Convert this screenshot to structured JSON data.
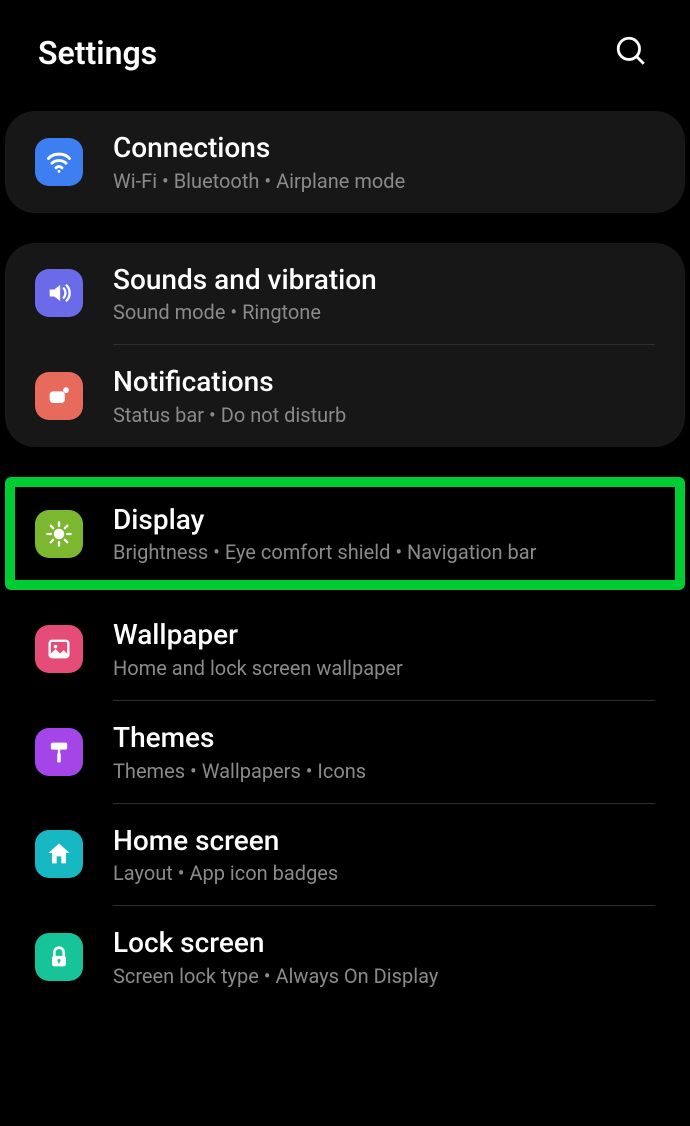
{
  "header": {
    "title": "Settings"
  },
  "groups": [
    {
      "type": "card",
      "items": [
        {
          "id": "connections",
          "title": "Connections",
          "subtitle": "Wi-Fi  •  Bluetooth  •  Airplane mode"
        }
      ]
    },
    {
      "type": "card",
      "items": [
        {
          "id": "sounds",
          "title": "Sounds and vibration",
          "subtitle": "Sound mode  •  Ringtone"
        },
        {
          "id": "notifications",
          "title": "Notifications",
          "subtitle": "Status bar  •  Do not disturb"
        }
      ]
    },
    {
      "type": "highlighted",
      "items": [
        {
          "id": "display",
          "title": "Display",
          "subtitle": "Brightness  •  Eye comfort shield  •  Navigation bar"
        }
      ]
    },
    {
      "type": "plain",
      "items": [
        {
          "id": "wallpaper",
          "title": "Wallpaper",
          "subtitle": "Home and lock screen wallpaper"
        },
        {
          "id": "themes",
          "title": "Themes",
          "subtitle": "Themes  •  Wallpapers  •  Icons"
        },
        {
          "id": "homescreen",
          "title": "Home screen",
          "subtitle": "Layout  •  App icon badges"
        },
        {
          "id": "lockscreen",
          "title": "Lock screen",
          "subtitle": "Screen lock type  •  Always On Display"
        }
      ]
    }
  ]
}
